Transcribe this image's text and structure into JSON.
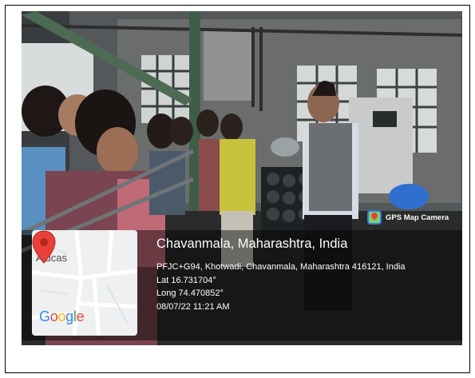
{
  "badge": {
    "label": "GPS Map Camera",
    "icon": "gps-map-camera-logo-icon"
  },
  "map": {
    "place_label": "Alucas",
    "logo_letters": [
      {
        "char": "G",
        "color": "#4285F4"
      },
      {
        "char": "o",
        "color": "#EA4335"
      },
      {
        "char": "o",
        "color": "#FBBC05"
      },
      {
        "char": "g",
        "color": "#4285F4"
      },
      {
        "char": "l",
        "color": "#34A853"
      },
      {
        "char": "e",
        "color": "#EA4335"
      }
    ],
    "pin_icon": "map-pin-icon",
    "pin_color": "#e8413a"
  },
  "info": {
    "title": "Chavanmala, Maharashtra, India",
    "address": "PFJC+G94, Khotwadi, Chavanmala, Maharashtra 416121, India",
    "lat": "Lat 16.731704°",
    "long": "Long 74.470852°",
    "datetime": "08/07/22 11:21 AM"
  }
}
